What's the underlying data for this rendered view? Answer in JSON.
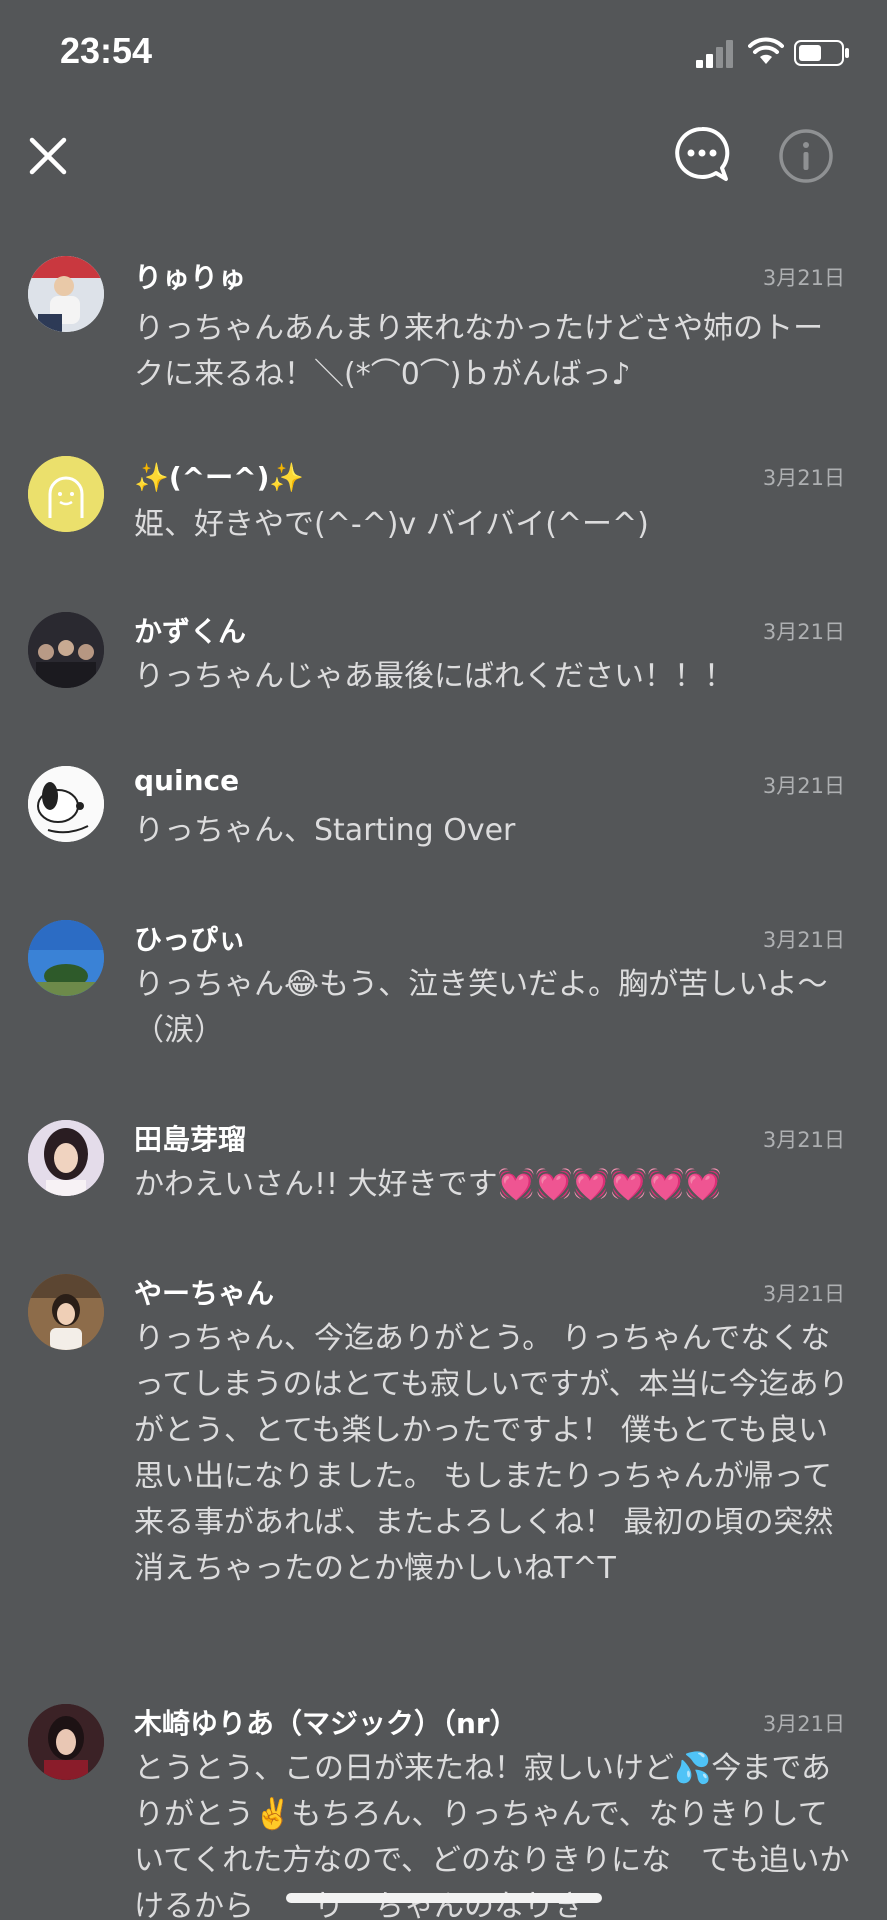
{
  "status": {
    "time": "23:54"
  },
  "header": {
    "close_icon": "close-icon",
    "chat_icon": "chat-bubble-icon",
    "info_icon": "info-icon"
  },
  "messages": [
    {
      "name": "りゅりゅ",
      "date": "3月21日",
      "text": "りっちゃんあんまり来れなかったけどさや姉のトークに来るね！＼(*⌒0⌒)ｂがんばっ♪"
    },
    {
      "name": "✨(^ー^)✨",
      "date": "3月21日",
      "text": "姫、好きやで(^-^)v バイバイ(^ー^)"
    },
    {
      "name": "かずくん",
      "date": "3月21日",
      "text": "りっちゃんじゃあ最後にばれください！！！"
    },
    {
      "name": "quince",
      "date": "3月21日",
      "text": "りっちゃん、Starting Over"
    },
    {
      "name": "ひっぴぃ",
      "date": "3月21日",
      "text": "りっちゃん😂もう、泣き笑いだよ。胸が苦しいよ〜（涙）"
    },
    {
      "name": "田島芽瑠",
      "date": "3月21日",
      "text": "かわえいさん!! 大好きです💓💓💓💓💓💓"
    },
    {
      "name": "やーちゃん",
      "date": "3月21日",
      "text": "りっちゃん、今迄ありがとう。 りっちゃんでなくなってしまうのはとても寂しいですが、本当に今迄ありがとう、とても楽しかったですよ！ 僕もとても良い思い出になりました。 もしまたりっちゃんが帰って来る事があれば、またよろしくね！ 最初の頃の突然消えちゃったのとか懐かしいねT^T"
    },
    {
      "name": "木崎ゆりあ（マジック）（nr）",
      "date": "3月21日",
      "text": "とうとう、この日が来たね！寂しいけど💦今までありがとう✌️もちろん、りっちゃんで、なりきりしていてくれた方なので、どのなりきりにな　ても追いかけるから　　り　ちゃんのなりき"
    }
  ]
}
